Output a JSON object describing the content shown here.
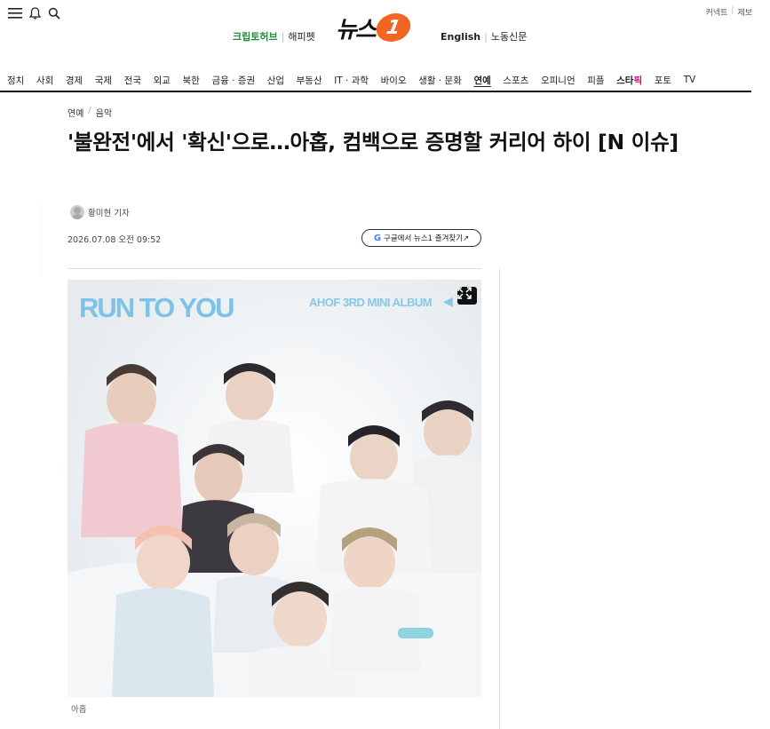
{
  "topbar": {
    "right_links": [
      "커넥트",
      "제보"
    ],
    "promo_left": {
      "item1": "크립토허브",
      "item2": "해피펫"
    },
    "promo_right": {
      "item1": "English",
      "item2": "노동신문"
    },
    "logo": {
      "text": "뉴스",
      "mark": "1"
    }
  },
  "nav": {
    "items": [
      "정치",
      "사회",
      "경제",
      "국제",
      "전국",
      "외교",
      "북한",
      "금융 · 증권",
      "산업",
      "부동산",
      "IT · 과학",
      "바이오",
      "생활 · 문화",
      "연예",
      "스포츠",
      "오피니언",
      "피플",
      "포토",
      "TV"
    ],
    "active": "연예",
    "star_label": {
      "main": "스타",
      "sub": "픽"
    }
  },
  "article": {
    "breadcrumb": [
      "연예",
      "음악"
    ],
    "headline": "'불완전'에서 '확신'으로…아홉, 컴백으로 증명할 커리어 하이 [N 이슈]",
    "author": "황미현 기자",
    "date": "2026.07.08 오전 09:52",
    "google_button": "구글에서 뉴스1 즐겨찾기↗",
    "photo_title": "RUN TO YOU",
    "photo_subtitle": "AHOF 3RD MINI ALBUM",
    "caption": "아홉"
  },
  "icons": {
    "menu": "hamburger-menu-icon",
    "bell": "bell-icon",
    "search": "search-icon",
    "expand": "expand-icon",
    "google": "google-g-icon"
  },
  "colors": {
    "brand_orange": "#f26522",
    "promo_green": "#1e8a3a",
    "photo_text": "#7ec3e6"
  }
}
